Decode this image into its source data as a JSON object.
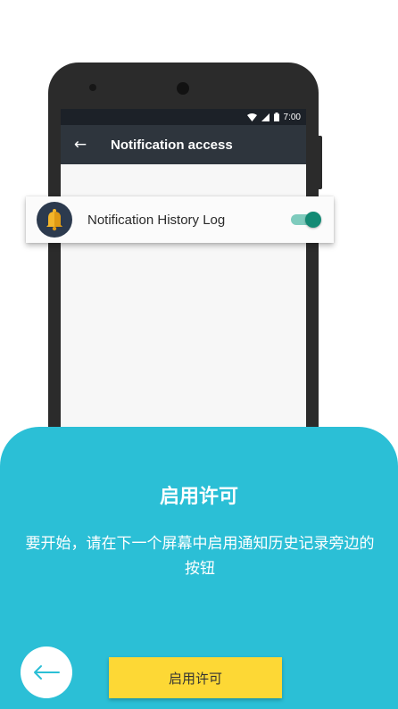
{
  "status_bar": {
    "time": "7:00"
  },
  "app_bar": {
    "title": "Notification access"
  },
  "permission_item": {
    "label": "Notification History Log",
    "enabled": true
  },
  "onboarding": {
    "title": "启用许可",
    "description": "要开始，请在下一个屏幕中启用通知历史记录旁边的按钮",
    "primary_button": "启用许可"
  },
  "colors": {
    "panel": "#2bbfd6",
    "button": "#fdd835",
    "toggle_on": "#138a74",
    "app_icon_bg": "#2c3a4e",
    "app_bar": "#2e353d"
  },
  "icons": {
    "back_arrow": "arrow-left-icon",
    "app_icon": "bell-icon",
    "nav_back": "arrow-left-icon"
  }
}
